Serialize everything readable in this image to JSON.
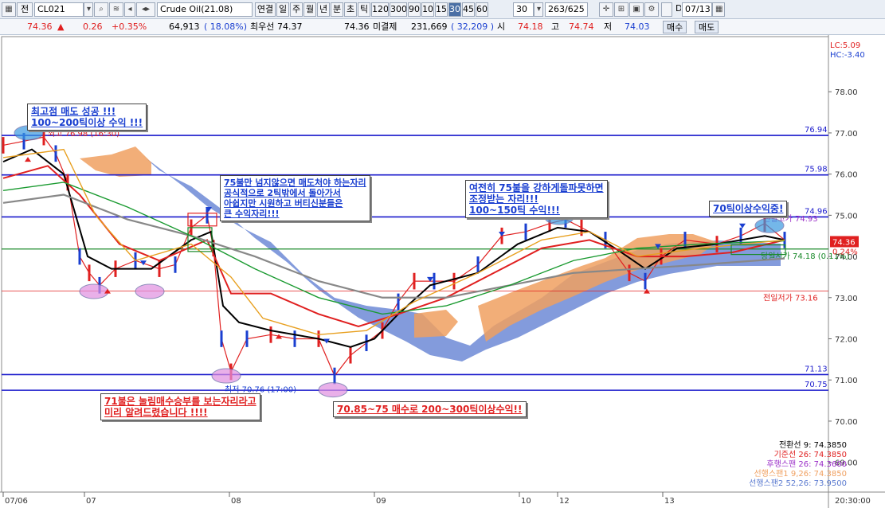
{
  "toolbar": {
    "item1": "전",
    "code": "CL021",
    "product": "Crude Oil(21.08)",
    "periods": [
      "연결",
      "일",
      "주",
      "월",
      "년",
      "분",
      "초",
      "틱",
      "120",
      "300",
      "90",
      "10",
      "15",
      "30",
      "45",
      "60"
    ],
    "active_period": "30",
    "interval_value": "30",
    "count": "263/625",
    "d_label": "D",
    "date": "07/13"
  },
  "quote": {
    "price": "74.36",
    "change": "0.26",
    "change_pct": "+0.35%",
    "volume": "64,913",
    "vol_ratio": "( 18.08%)",
    "best_label": "최우선",
    "best_bid": "74.37",
    "best_ask": "74.36",
    "oi_label": "미결제",
    "oi": "231,669",
    "oi_change": "( 32,209 )",
    "open_label": "시",
    "open": "74.18",
    "high_label": "고",
    "high": "74.74",
    "low_label": "저",
    "low": "74.03",
    "sell_button": "매수",
    "buy_button": "매도"
  },
  "chart": {
    "lc_hc": [
      "LC:5.09",
      "HC:-3.40"
    ],
    "y_ticks": [
      "76.00",
      "77.00",
      "78.00",
      "75.00",
      "74.00",
      "73.00",
      "72.00",
      "71.00",
      "70.00",
      "69.00"
    ],
    "y_values": [
      76,
      77,
      78,
      75,
      74,
      73,
      72,
      71,
      70,
      69
    ],
    "x_ticks": [
      "07/06",
      "07",
      "08",
      "09",
      "10",
      "12",
      "13"
    ],
    "time": "20:30:00",
    "levels": [
      {
        "label": "76.94",
        "value": 76.94,
        "color": "#1a1acc"
      },
      {
        "label": "75.98",
        "value": 75.98,
        "color": "#1a1acc"
      },
      {
        "label": "74.96",
        "value": 74.96,
        "color": "#1a1acc"
      },
      {
        "label": "71.13",
        "value": 71.13,
        "color": "#1a1acc"
      },
      {
        "label": "70.75",
        "value": 70.75,
        "color": "#1a1acc"
      }
    ],
    "prev_low_label": "전일저가 73.16",
    "prev_high_label": "전일고가 74.93",
    "current_tag": "74.36",
    "pct_tag": "0.24%",
    "open_line_label": "당일시가 74.18 (0.11%)",
    "high_marker": "최고 76.98 (16:30)",
    "low_marker": "최저 70.76 (17:00)"
  },
  "annotations": {
    "a1": "최고점 매도 성공 !!!\n100~200틱이상 수익 !!!",
    "a2": "75불만 넘지않으면 매도처야 하는자리\n공식적으로 2틱밖에서 돌아가서\n아쉽지만 시원하고 버티신분들은\n큰 수익자리!!!",
    "a3": "여전히 75불을 강하게돌파못하면\n조정받는 자리!!!\n100~150틱 수익!!!",
    "a4": "70틱이상수익중!",
    "a5": "71불은 눌림매수승부를 보는자리라고\n미리 알려드렸습니다 !!!!",
    "a6": "70.85~75 매수로 200~300틱이상수익!!"
  },
  "legend": [
    {
      "label": "전환선 9: 74.3850",
      "color": "#000000"
    },
    {
      "label": "기준선 26: 74.3850",
      "color": "#e02020"
    },
    {
      "label": "후행스팬 26: 74.3600",
      "color": "#9b30c8"
    },
    {
      "label": "선행스팬1 9,26: 74.3850",
      "color": "#f0a060"
    },
    {
      "label": "선행스팬2 52,26: 73.9500",
      "color": "#5a7ad0"
    }
  ]
}
